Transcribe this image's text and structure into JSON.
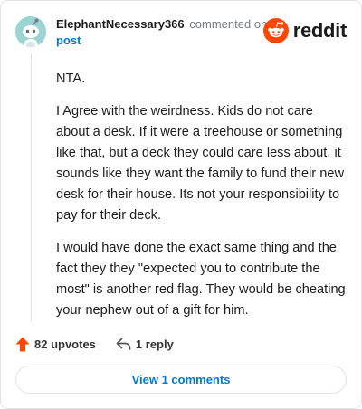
{
  "comment": {
    "username": "ElephantNecessary366",
    "commented_on": "commented on",
    "post_link": "post",
    "paragraphs": [
      "NTA.",
      "I Agree with the weirdness. Kids do not care about a desk. If it were a treehouse or something like that, but a deck they could care less about. it sounds like they want the family to fund their new desk for their house. Its not your responsibility to pay for their deck.",
      "I would have done the exact same thing and the fact they they \"expected you to contribute the most\" is another red flag. They would be cheating your nephew out of a gift for him."
    ]
  },
  "brand": {
    "name": "reddit",
    "logo_icon": "reddit-snoo-icon",
    "color": "#ff4500"
  },
  "actions": {
    "upvotes": "82 upvotes",
    "reply": "1 reply",
    "upvote_icon": "upvote-arrow-icon",
    "reply_icon": "reply-arrow-icon",
    "upvote_color": "#ff4500"
  },
  "view_comments": {
    "label": "View 1 comments"
  },
  "avatar": {
    "icon": "snoo-avatar-icon",
    "bg_color": "#9bd4d2"
  }
}
